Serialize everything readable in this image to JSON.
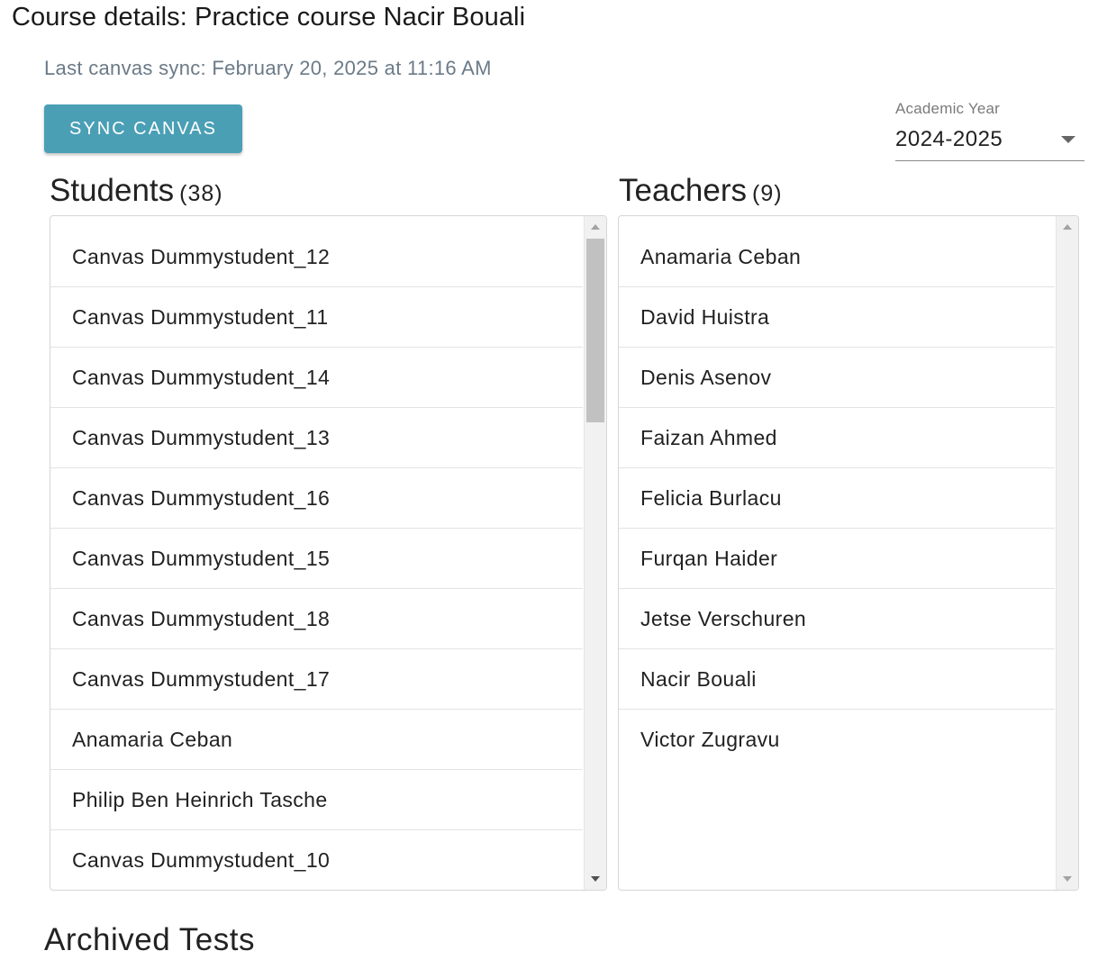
{
  "header": {
    "title": "Course details: Practice course Nacir Bouali",
    "last_sync": "Last canvas sync: February 20, 2025 at 11:16 AM",
    "sync_button_label": "SYNC CANVAS"
  },
  "academic_year": {
    "label": "Academic Year",
    "selected": "2024-2025"
  },
  "students": {
    "heading": "Students",
    "count": "(38)",
    "items": [
      "Canvas Dummystudent_12",
      "Canvas Dummystudent_11",
      "Canvas Dummystudent_14",
      "Canvas Dummystudent_13",
      "Canvas Dummystudent_16",
      "Canvas Dummystudent_15",
      "Canvas Dummystudent_18",
      "Canvas Dummystudent_17",
      "Anamaria Ceban",
      "Philip Ben Heinrich Tasche",
      "Canvas Dummystudent_10"
    ]
  },
  "teachers": {
    "heading": "Teachers",
    "count": "(9)",
    "items": [
      "Anamaria Ceban",
      "David Huistra",
      "Denis Asenov",
      "Faizan Ahmed",
      "Felicia Burlacu",
      "Furqan Haider",
      "Jetse Verschuren",
      "Nacir Bouali",
      "Victor Zugravu"
    ]
  },
  "archived": {
    "heading": "Archived Tests"
  },
  "colors": {
    "accent": "#4a9fb5",
    "muted_text": "#6b7a87"
  }
}
